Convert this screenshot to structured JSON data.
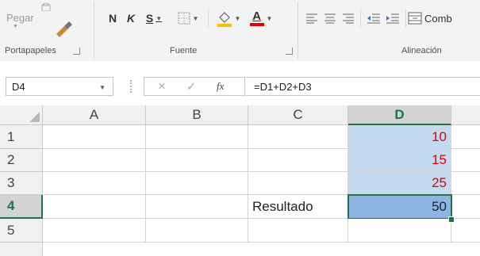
{
  "ribbon": {
    "paste_label": "Pegar",
    "bold_label": "N",
    "italic_label": "K",
    "underline_label": "S",
    "font_color_letter": "A",
    "merge_label": "Comb",
    "groups": {
      "clipboard": "Portapapeles",
      "font": "Fuente",
      "alignment": "Alineación"
    },
    "font_color": "#e00000",
    "fill_color": "#f5c200"
  },
  "formula_bar": {
    "name_box_value": "D4",
    "cancel_icon": "×",
    "enter_icon": "✓",
    "fx_label": "fx",
    "formula": "=D1+D2+D3"
  },
  "grid": {
    "columns": [
      "A",
      "B",
      "C",
      "D"
    ],
    "rows": [
      "1",
      "2",
      "3",
      "4",
      "5"
    ],
    "selected_column": "D",
    "selected_row": "4",
    "cells": {
      "C4": "Resultado",
      "D1": "10",
      "D2": "15",
      "D3": "25",
      "D4": "50"
    },
    "colors": {
      "red_values": "#e00000",
      "selected_accent": "#217346",
      "highlight": "#c5d9f1",
      "active_fill": "#8db4e2"
    }
  }
}
